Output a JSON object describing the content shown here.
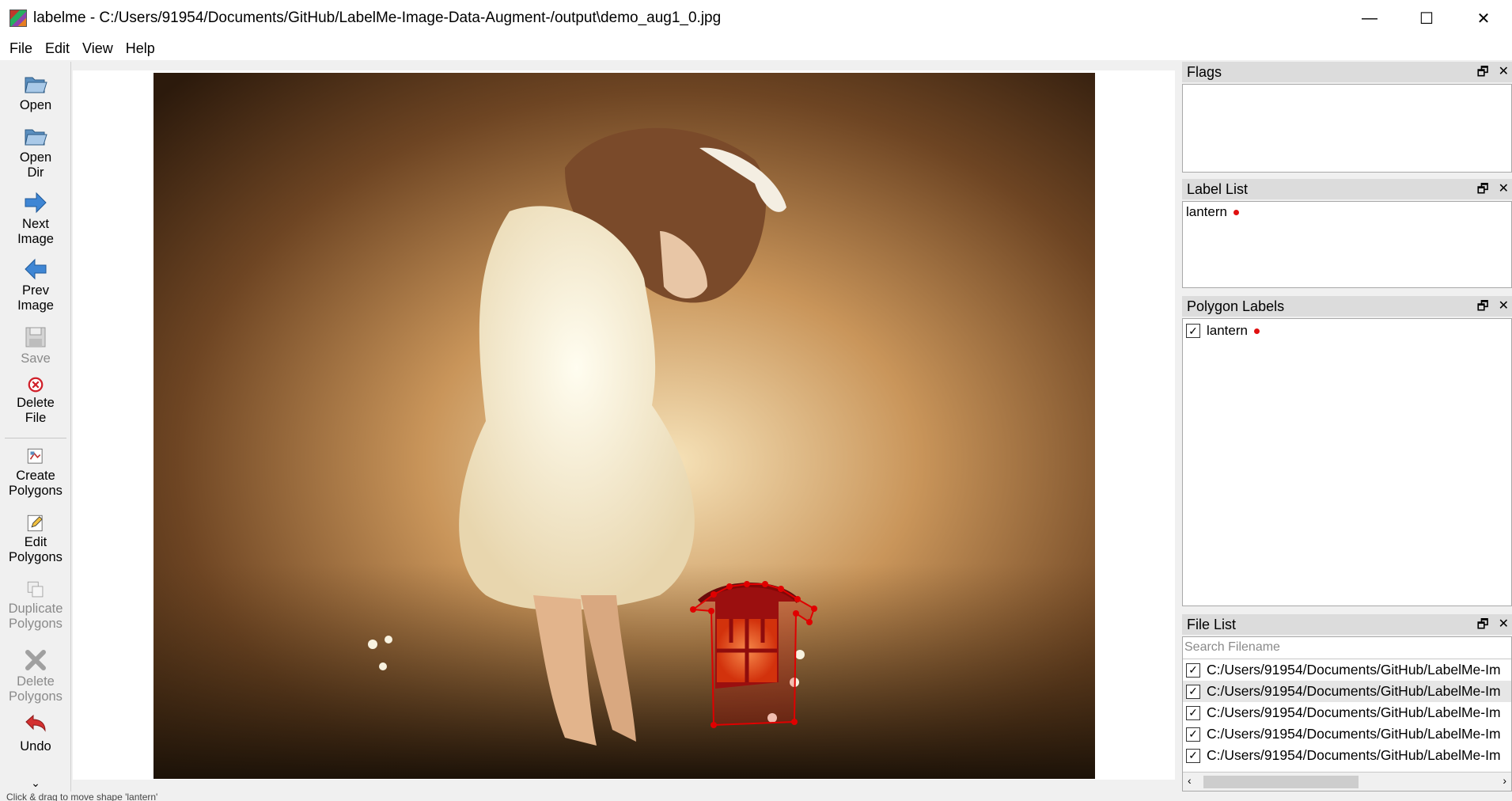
{
  "window": {
    "title": "labelme - C:/Users/91954/Documents/GitHub/LabelMe-Image-Data-Augment-/output\\demo_aug1_0.jpg",
    "minimize": "—",
    "maximize": "☐",
    "close": "✕"
  },
  "menu": [
    "File",
    "Edit",
    "View",
    "Help"
  ],
  "toolbar": {
    "open": "Open",
    "open_dir": [
      "Open",
      "Dir"
    ],
    "next_image": [
      "Next",
      "Image"
    ],
    "prev_image": [
      "Prev",
      "Image"
    ],
    "save": "Save",
    "delete_file": [
      "Delete",
      "File"
    ],
    "create_polygons": [
      "Create",
      "Polygons"
    ],
    "edit_polygons": [
      "Edit",
      "Polygons"
    ],
    "duplicate_polygons": [
      "Duplicate",
      "Polygons"
    ],
    "delete_polygons": [
      "Delete",
      "Polygons"
    ],
    "undo": "Undo",
    "more": "⌄"
  },
  "docks": {
    "flags": {
      "title": "Flags"
    },
    "label_list": {
      "title": "Label List",
      "items": [
        {
          "label": "lantern",
          "color": "#e01010"
        }
      ]
    },
    "polygon_labels": {
      "title": "Polygon Labels",
      "items": [
        {
          "label": "lantern",
          "checked": true,
          "color": "#e01010"
        }
      ]
    },
    "file_list": {
      "title": "File List",
      "search_placeholder": "Search Filename",
      "files": [
        {
          "path": "C:/Users/91954/Documents/GitHub/LabelMe-Im",
          "checked": true,
          "selected": false
        },
        {
          "path": "C:/Users/91954/Documents/GitHub/LabelMe-Im",
          "checked": true,
          "selected": true
        },
        {
          "path": "C:/Users/91954/Documents/GitHub/LabelMe-Im",
          "checked": true,
          "selected": false
        },
        {
          "path": "C:/Users/91954/Documents/GitHub/LabelMe-Im",
          "checked": true,
          "selected": false
        },
        {
          "path": "C:/Users/91954/Documents/GitHub/LabelMe-Im",
          "checked": true,
          "selected": false
        }
      ]
    }
  },
  "dock_buttons": {
    "float": "🗗",
    "close": "✕"
  },
  "status": "Click & drag to move shape 'lantern'"
}
